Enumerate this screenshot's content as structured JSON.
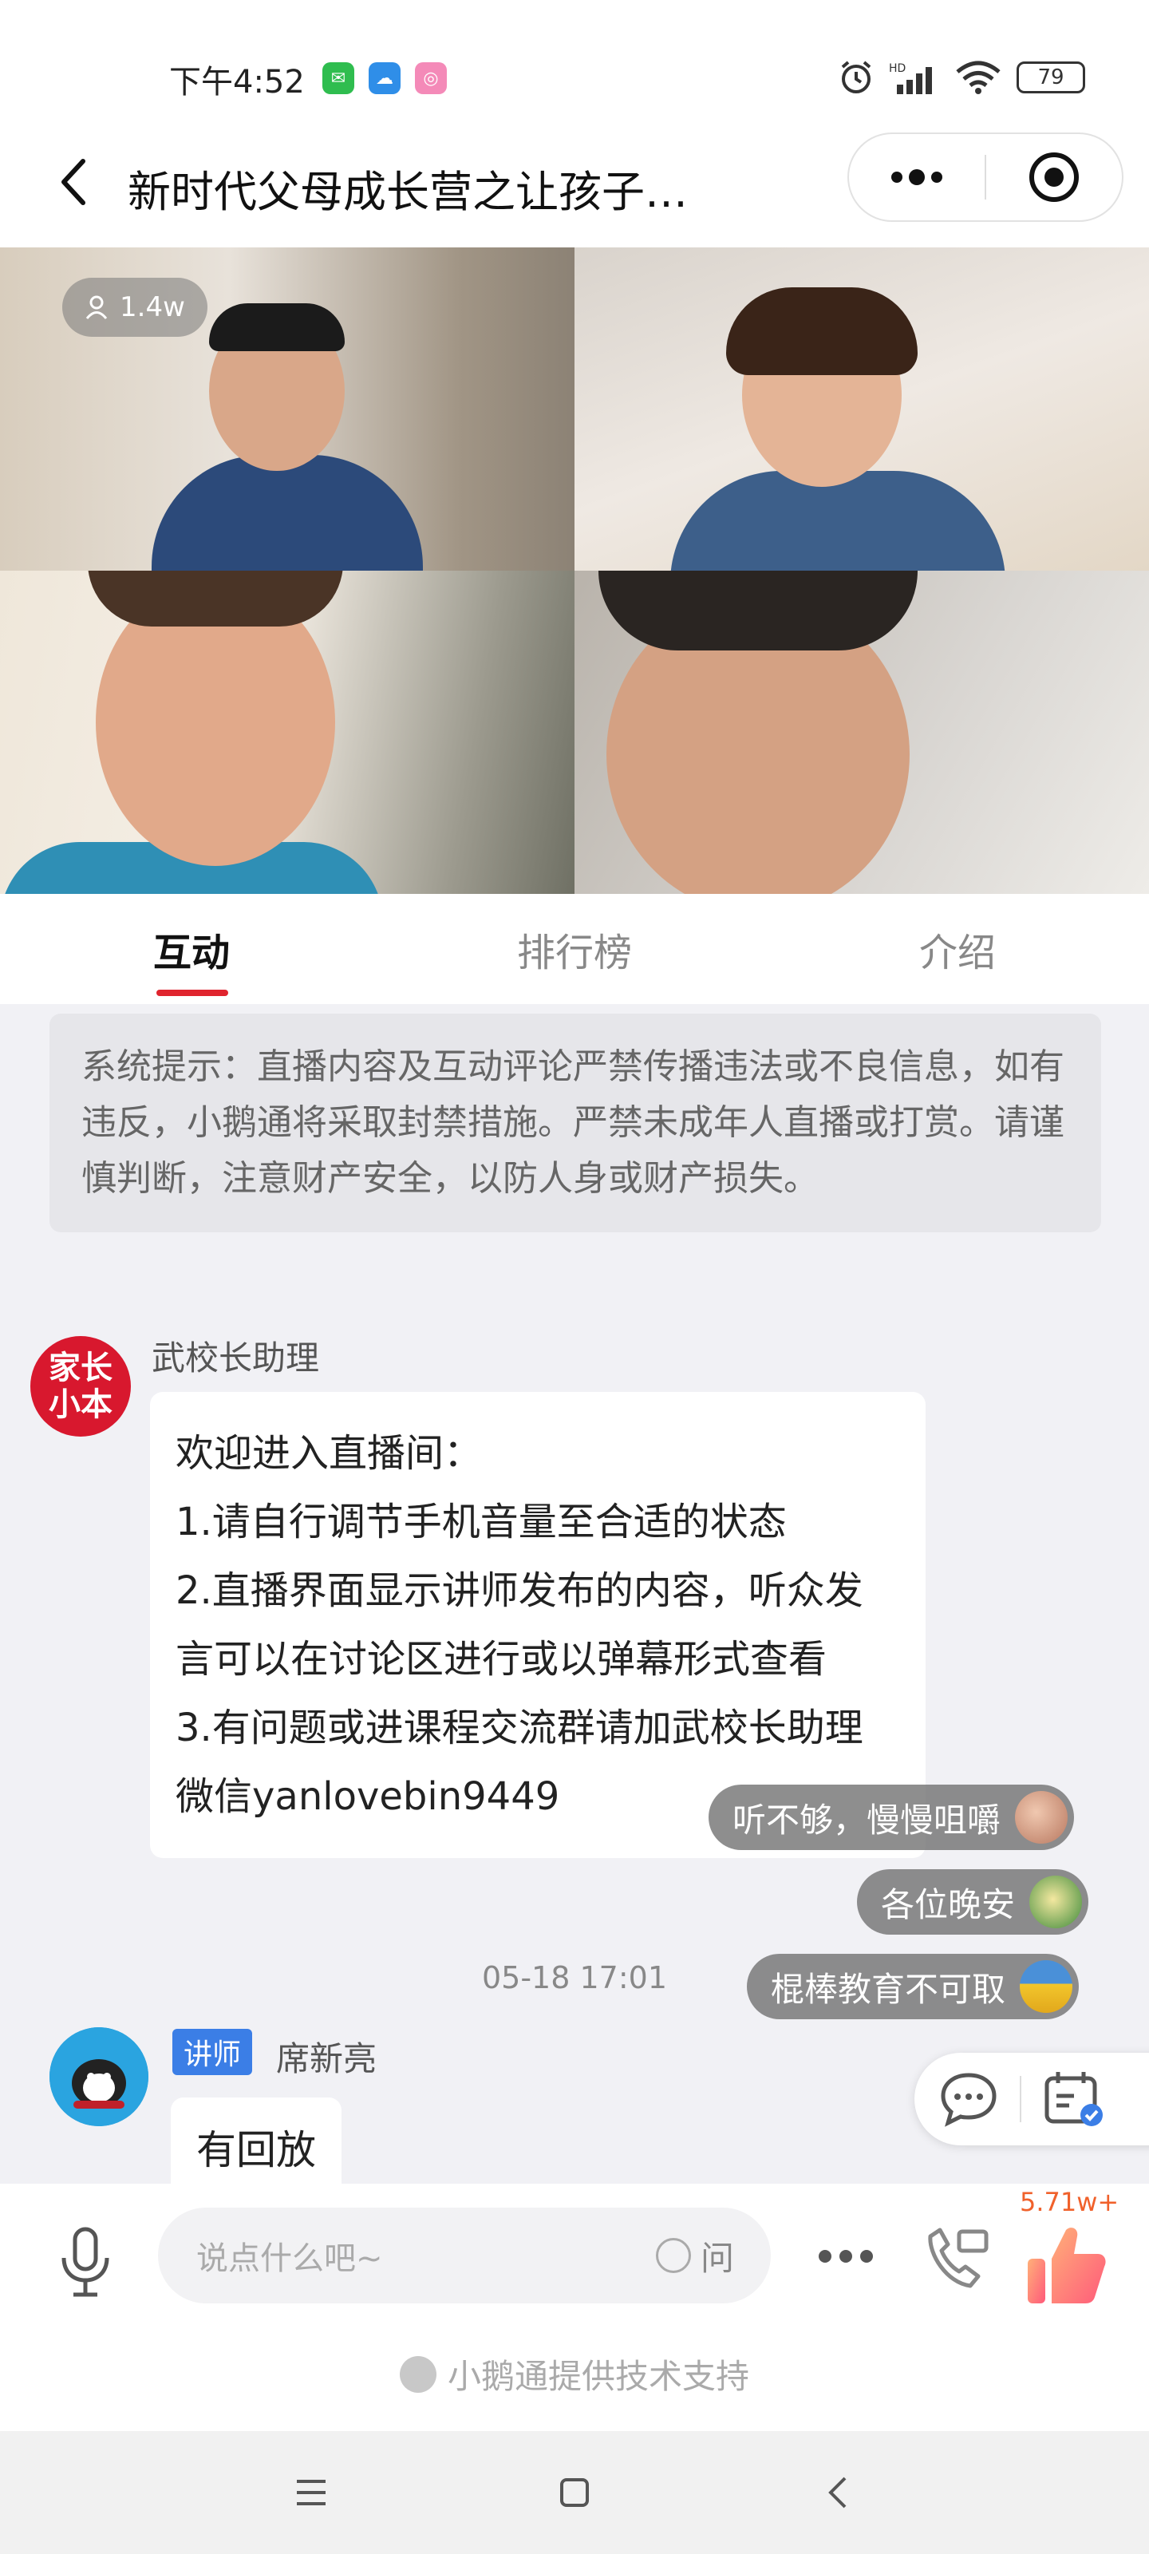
{
  "status_bar": {
    "time": "下午4:52",
    "battery": "79",
    "apps": [
      "wechat-icon",
      "cloud-icon",
      "camera-app-icon"
    ],
    "indicators": [
      "alarm-icon",
      "hd-signal-icon",
      "wifi-icon"
    ]
  },
  "header": {
    "title": "新时代父母成长营之让孩子…"
  },
  "live": {
    "viewers": "1.4w"
  },
  "tabs": [
    {
      "label": "互动",
      "active": true
    },
    {
      "label": "排行榜",
      "active": false
    },
    {
      "label": "介绍",
      "active": false
    }
  ],
  "system_notice": "系统提示：直播内容及互动评论严禁传播违法或不良信息，如有违反，小鹅通将采取封禁措施。严禁未成年人直播或打赏。请谨慎判断，注意财产安全，以防人身或财产损失。",
  "messages": [
    {
      "sender": "武校长助理",
      "avatar_text": "家长\n小本",
      "text": "欢迎进入直播间：\n1.请自行调节手机音量至合适的状态\n2.直播界面显示讲师发布的内容，听众发言可以在讨论区进行或以弹幕形式查看\n3.有问题或进课程交流群请加武校长助理微信yanlovebin9449"
    },
    {
      "timestamp": "05-18 17:01",
      "role_tag": "讲师",
      "sender": "席新亮",
      "text": "有回放"
    }
  ],
  "danmaku": [
    {
      "text": "听不够，慢慢咀嚼"
    },
    {
      "text": "各位晚安"
    },
    {
      "text": "棍棒教育不可取"
    }
  ],
  "input_bar": {
    "placeholder": "说点什么吧~",
    "ask_label": "问",
    "like_count": "5.71w+",
    "support_text": "小鹅通提供技术支持"
  },
  "colors": {
    "accent_red": "#e0242e",
    "lecturer_blue": "#3b7ee6",
    "like_orange": "#f0612b"
  }
}
